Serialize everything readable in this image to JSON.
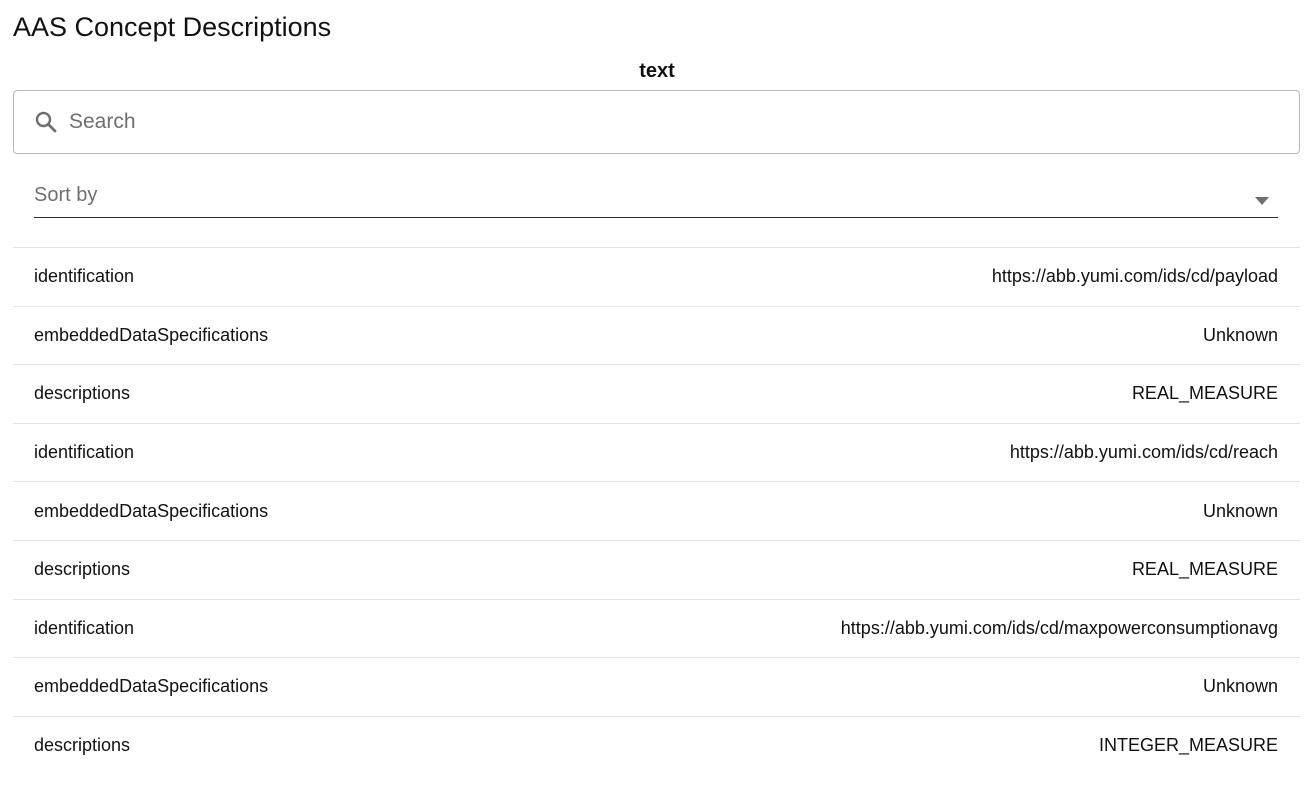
{
  "header": {
    "title": "AAS Concept Descriptions",
    "section_heading": "text"
  },
  "search": {
    "placeholder": "Search",
    "value": "",
    "icon": "search-icon"
  },
  "sort": {
    "placeholder": "Sort by",
    "icon": "chevron-down-icon"
  },
  "rows": [
    {
      "key": "identification",
      "value": "https://abb.yumi.com/ids/cd/payload"
    },
    {
      "key": "embeddedDataSpecifications",
      "value": "Unknown"
    },
    {
      "key": "descriptions",
      "value": "REAL_MEASURE"
    },
    {
      "key": "identification",
      "value": "https://abb.yumi.com/ids/cd/reach"
    },
    {
      "key": "embeddedDataSpecifications",
      "value": "Unknown"
    },
    {
      "key": "descriptions",
      "value": "REAL_MEASURE"
    },
    {
      "key": "identification",
      "value": "https://abb.yumi.com/ids/cd/maxpowerconsumptionavg"
    },
    {
      "key": "embeddedDataSpecifications",
      "value": "Unknown"
    },
    {
      "key": "descriptions",
      "value": "INTEGER_MEASURE"
    }
  ],
  "colors": {
    "text": "#111111",
    "placeholder": "#6f6f6f",
    "border": "#b8b8b8",
    "divider": "#e4e4e4"
  }
}
